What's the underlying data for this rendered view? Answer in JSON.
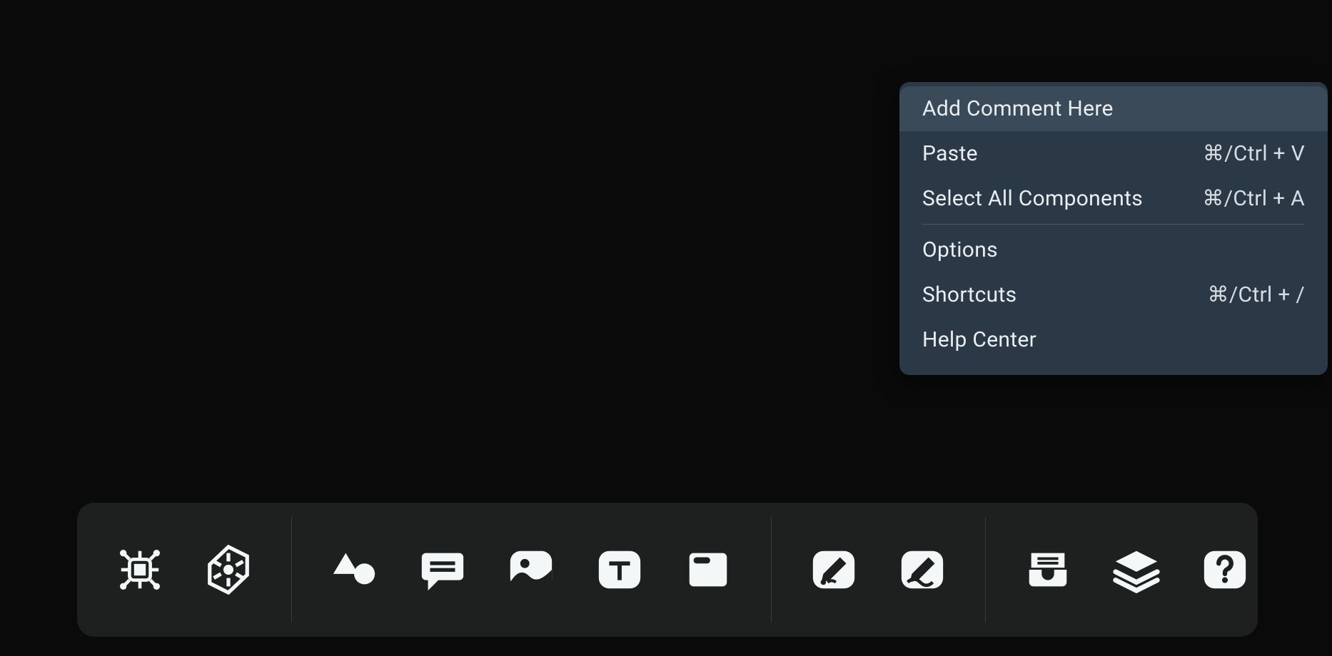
{
  "context_menu": {
    "items": [
      {
        "label": "Add Comment Here",
        "shortcut": "",
        "highlight": true
      },
      {
        "label": "Paste",
        "shortcut": "⌘/Ctrl + V"
      },
      {
        "label": "Select All Components",
        "shortcut": "⌘/Ctrl + A"
      },
      {
        "divider": true
      },
      {
        "label": "Options",
        "shortcut": ""
      },
      {
        "label": "Shortcuts",
        "shortcut": "⌘/Ctrl + /"
      },
      {
        "label": "Help Center",
        "shortcut": ""
      }
    ]
  },
  "toolbar": {
    "modes": [
      {
        "name": "cursor",
        "active": true
      },
      {
        "name": "hand",
        "active": false
      }
    ],
    "tools": [
      {
        "name": "chip-icon"
      },
      {
        "name": "helm-icon"
      },
      {
        "name": "shapes-icon"
      },
      {
        "name": "comment-icon"
      },
      {
        "name": "image-icon"
      },
      {
        "name": "text-icon"
      },
      {
        "name": "card-icon"
      },
      {
        "name": "pencil-square-icon"
      },
      {
        "name": "freehand-icon"
      },
      {
        "name": "inbox-icon"
      },
      {
        "name": "layers-icon"
      },
      {
        "name": "help-icon"
      }
    ]
  },
  "colors": {
    "accent": "#57c4ad",
    "panel": "#2b3946",
    "toolbar": "#1e1f1f",
    "bg": "#0a0a0a"
  }
}
